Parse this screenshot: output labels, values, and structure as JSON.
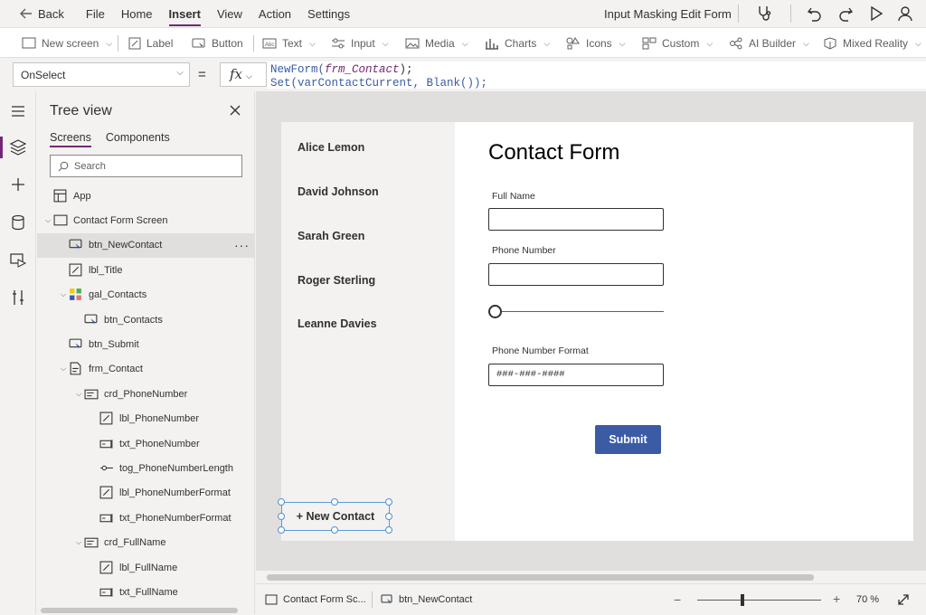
{
  "topbar": {
    "back_label": "Back",
    "menu": [
      "File",
      "Home",
      "Insert",
      "View",
      "Action",
      "Settings"
    ],
    "active_menu": "Insert",
    "app_title": "Input Masking Edit Form"
  },
  "ribbon": {
    "items": [
      {
        "label": "New screen",
        "icon": "new-screen-icon",
        "dropdown": true
      },
      {
        "label": "Label",
        "icon": "label-icon",
        "dropdown": false
      },
      {
        "label": "Button",
        "icon": "button-icon",
        "dropdown": false
      },
      {
        "label": "Text",
        "icon": "text-icon",
        "dropdown": true
      },
      {
        "label": "Input",
        "icon": "input-icon",
        "dropdown": true
      },
      {
        "label": "Media",
        "icon": "media-icon",
        "dropdown": true
      },
      {
        "label": "Charts",
        "icon": "charts-icon",
        "dropdown": true
      },
      {
        "label": "Icons",
        "icon": "icons-icon",
        "dropdown": true
      },
      {
        "label": "Custom",
        "icon": "custom-icon",
        "dropdown": true
      },
      {
        "label": "AI Builder",
        "icon": "ai-builder-icon",
        "dropdown": true
      },
      {
        "label": "Mixed Reality",
        "icon": "mixed-reality-icon",
        "dropdown": true
      }
    ]
  },
  "formula": {
    "property": "OnSelect",
    "eq": "=",
    "fx": "fx",
    "line1_fn": "NewForm(",
    "line1_ref": "frm_Contact",
    "line1_end": ");",
    "line2": "Set(varContactCurrent, Blank());"
  },
  "treeview": {
    "title": "Tree view",
    "tabs": [
      "Screens",
      "Components"
    ],
    "active_tab": "Screens",
    "search_placeholder": "Search",
    "rows": [
      {
        "label": "App",
        "icon": "app-icon",
        "indent": 0,
        "caret": ""
      },
      {
        "label": "Contact Form Screen",
        "icon": "screen-icon",
        "indent": 0,
        "caret": "v"
      },
      {
        "label": "btn_NewContact",
        "icon": "button-icon",
        "indent": 1,
        "caret": "",
        "selected": true
      },
      {
        "label": "lbl_Title",
        "icon": "label-icon",
        "indent": 1,
        "caret": ""
      },
      {
        "label": "gal_Contacts",
        "icon": "gallery-icon",
        "indent": 1,
        "caret": "v"
      },
      {
        "label": "btn_Contacts",
        "icon": "button-icon",
        "indent": 2,
        "caret": ""
      },
      {
        "label": "btn_Submit",
        "icon": "button-icon",
        "indent": 1,
        "caret": ""
      },
      {
        "label": "frm_Contact",
        "icon": "form-icon",
        "indent": 1,
        "caret": "v"
      },
      {
        "label": "crd_PhoneNumber",
        "icon": "card-icon",
        "indent": 2,
        "caret": "v"
      },
      {
        "label": "lbl_PhoneNumber",
        "icon": "label-icon",
        "indent": 3,
        "caret": ""
      },
      {
        "label": "txt_PhoneNumber",
        "icon": "textinput-icon",
        "indent": 3,
        "caret": ""
      },
      {
        "label": "tog_PhoneNumberLength",
        "icon": "toggle-icon",
        "indent": 3,
        "caret": ""
      },
      {
        "label": "lbl_PhoneNumberFormat",
        "icon": "label-icon",
        "indent": 3,
        "caret": ""
      },
      {
        "label": "txt_PhoneNumberFormat",
        "icon": "textinput-icon",
        "indent": 3,
        "caret": ""
      },
      {
        "label": "crd_FullName",
        "icon": "card-icon",
        "indent": 2,
        "caret": "v"
      },
      {
        "label": "lbl_FullName",
        "icon": "label-icon",
        "indent": 3,
        "caret": ""
      },
      {
        "label": "txt_FullName",
        "icon": "textinput-icon",
        "indent": 3,
        "caret": ""
      }
    ]
  },
  "canvas": {
    "contacts": [
      "Alice Lemon",
      "David Johnson",
      "Sarah Green",
      "Roger Sterling",
      "Leanne Davies"
    ],
    "form_title": "Contact Form",
    "full_name_label": "Full Name",
    "full_name_value": "",
    "phone_label": "Phone Number",
    "phone_value": "",
    "toggle_value": 0,
    "format_label": "Phone Number Format",
    "format_value": "###-###-####",
    "submit_label": "Submit",
    "new_contact_label": "+ New Contact"
  },
  "bottombar": {
    "screen_label": "Contact Form Sc...",
    "control_label": "btn_NewContact",
    "zoom_minus": "−",
    "zoom_plus": "+",
    "zoom_value": "70  %"
  },
  "colors": {
    "accent": "#742774",
    "button_blue": "#3b5ba5",
    "selection": "#5b9bd5"
  }
}
